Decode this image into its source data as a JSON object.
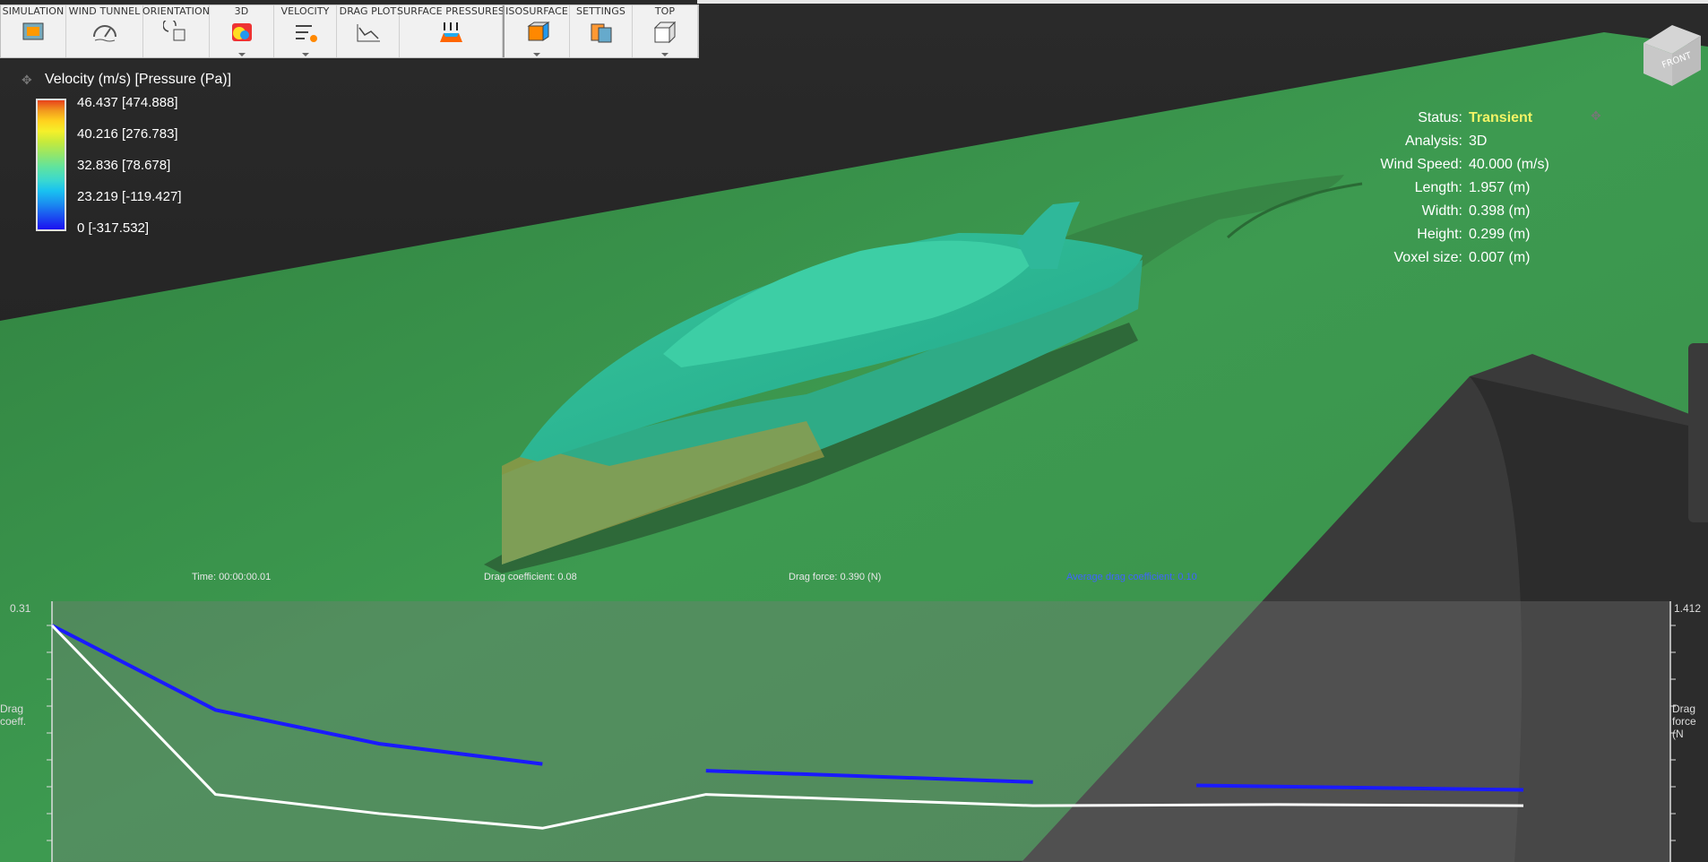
{
  "toolbar": {
    "items": [
      {
        "label": "SIMULATION",
        "icon": "simulation-icon"
      },
      {
        "label": "WIND TUNNEL",
        "icon": "wind-tunnel-icon"
      },
      {
        "label": "ORIENTATION",
        "icon": "orientation-icon"
      },
      {
        "label": "3D",
        "icon": "3d-view-icon"
      },
      {
        "label": "VELOCITY",
        "icon": "velocity-icon"
      },
      {
        "label": "DRAG PLOT",
        "icon": "drag-plot-icon"
      },
      {
        "label": "SURFACE PRESSURES",
        "icon": "surface-pressures-icon"
      },
      {
        "label": "ISOSURFACE",
        "icon": "isosurface-icon"
      },
      {
        "label": "SETTINGS",
        "icon": "settings-icon"
      },
      {
        "label": "TOP",
        "icon": "top-view-icon"
      }
    ]
  },
  "legend": {
    "title": "Velocity (m/s) [Pressure (Pa)]",
    "ticks": [
      "46.437 [474.888]",
      "40.216 [276.783]",
      "32.836 [78.678]",
      "23.219 [-119.427]",
      "0 [-317.532]"
    ]
  },
  "info": {
    "status_label": "Status:",
    "status_value": "Transient",
    "analysis_label": "Analysis:",
    "analysis_value": "3D",
    "wind_label": "Wind Speed:",
    "wind_value": "40.000 (m/s)",
    "length_label": "Length:",
    "length_value": "1.957 (m)",
    "width_label": "Width:",
    "width_value": "0.398 (m)",
    "height_label": "Height:",
    "height_value": "0.299 (m)",
    "voxel_label": "Voxel size:",
    "voxel_value": "0.007 (m)"
  },
  "bottom": {
    "time": "Time: 00:00:00.01",
    "drag_coefficient": "Drag coefficient: 0.08",
    "drag_force": "Drag force: 0.390 (N)",
    "avg_drag": "Average drag coefficient: 0.10"
  },
  "chart_data": {
    "type": "line",
    "left_axis": {
      "label": "Drag coeff.",
      "top_value": "0.31"
    },
    "right_axis": {
      "label": "Drag force (N",
      "top_value": "1.412"
    },
    "series": [
      {
        "color": "#1a1aff",
        "segments": [
          [
            [
              0,
              0.31
            ],
            [
              1,
              0.235
            ],
            [
              2,
              0.205
            ],
            [
              3,
              0.187
            ]
          ],
          [
            [
              4,
              0.181
            ],
            [
              6,
              0.171
            ]
          ],
          [
            [
              7,
              0.168
            ],
            [
              9,
              0.164
            ]
          ]
        ]
      },
      {
        "color": "#ffffff",
        "points": [
          [
            0,
            0.31
          ],
          [
            1,
            0.16
          ],
          [
            2,
            0.143
          ],
          [
            3,
            0.13
          ],
          [
            4,
            0.16
          ],
          [
            6,
            0.15
          ],
          [
            7.5,
            0.151
          ],
          [
            9,
            0.15
          ]
        ]
      }
    ],
    "x_range": [
      0,
      9
    ],
    "y_range": [
      0.1,
      0.31
    ]
  },
  "colors": {
    "ground": "#3e9850",
    "boat": "#2fb58f",
    "blue_series": "#1a1aff",
    "status": "#f4f466"
  }
}
